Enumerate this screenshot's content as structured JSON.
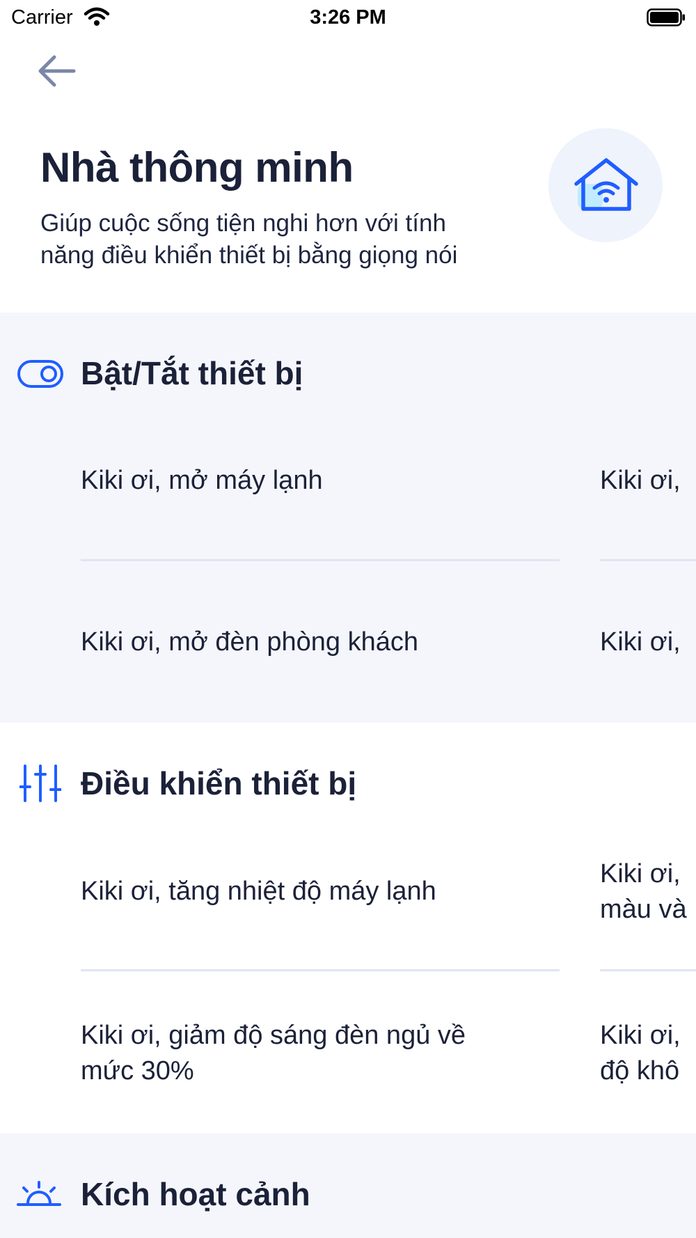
{
  "status_bar": {
    "carrier": "Carrier",
    "time": "3:26 PM"
  },
  "header": {
    "title": "Nhà thông minh",
    "subtitle_line1": "Giúp cuộc sống tiện nghi hơn với tính",
    "subtitle_line2": "năng điều khiển thiết bị bằng giọng nói",
    "icon": "smart-home-wifi-icon"
  },
  "sections": [
    {
      "title": "Bật/Tắt thiết bị",
      "icon": "toggle-icon",
      "commands": [
        {
          "line1": "Kiki ơi, mở máy lạnh"
        },
        {
          "line1": "Kiki ơi,"
        },
        {
          "line1": "Kiki ơi, mở đèn phòng khách"
        },
        {
          "line1": "Kiki ơi,"
        }
      ]
    },
    {
      "title": "Điều khiển thiết bị",
      "icon": "sliders-icon",
      "commands": [
        {
          "line1": "Kiki ơi, tăng nhiệt độ máy lạnh"
        },
        {
          "line1": "Kiki ơi,",
          "line2": "màu và"
        },
        {
          "line1": "Kiki ơi, giảm độ sáng đèn ngủ về",
          "line2": "mức 30%"
        },
        {
          "line1": "Kiki ơi,",
          "line2": "độ khô"
        }
      ]
    },
    {
      "title": "Kích hoạt cảnh",
      "icon": "sunrise-icon"
    }
  ],
  "colors": {
    "accent": "#1f5eff",
    "text": "#1b2138",
    "section_gray": "#f4f6fb",
    "divider": "#dfe5f3",
    "icon_circle": "#eff3fb"
  }
}
